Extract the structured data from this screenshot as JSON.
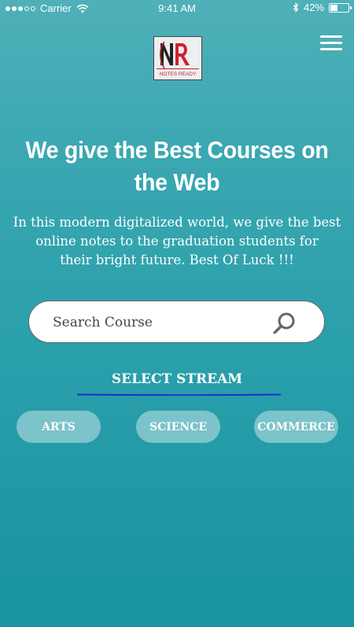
{
  "status_bar": {
    "carrier": "Carrier",
    "time": "9:41 AM",
    "battery": "42%",
    "battery_level": 0.42
  },
  "logo": {
    "text": "NR",
    "subtitle": "NOTES READY"
  },
  "hero": {
    "title": "We give the Best Courses on the Web",
    "tagline_lines": [
      "In this modern digitalized world, we give the best",
      "online notes to the graduation students for",
      "their bright future. Best Of Luck !!!"
    ]
  },
  "search": {
    "placeholder": "Search Course",
    "value": ""
  },
  "stream": {
    "heading": "SELECT STREAM",
    "options": [
      "ARTS",
      "SCIENCE",
      "COMMERCE"
    ]
  },
  "colors": {
    "underline": "#1a2bd6",
    "button_bg": "rgba(255,255,255,0.4)"
  },
  "icons": [
    "wifi-icon",
    "bluetooth-icon",
    "battery-icon",
    "menu-icon",
    "search-icon"
  ]
}
